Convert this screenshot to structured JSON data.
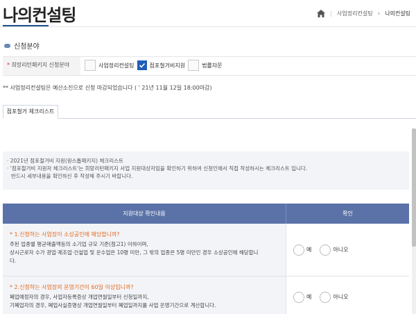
{
  "header": {
    "title": "나의컨설팅",
    "breadcrumb": [
      "사업정리컨설팅",
      "나의컨설팅"
    ]
  },
  "section": {
    "title": "신청분야"
  },
  "field": {
    "label": "희망리턴패키지 신청분야",
    "options": [
      {
        "label": "사업정리컨설팅",
        "checked": false
      },
      {
        "label": "점포철거비지원",
        "checked": true
      },
      {
        "label": "법률자문",
        "checked": false
      }
    ]
  },
  "notice": "** 사업정리컨설팅은 예산소진으로 신청 마감되었습니다 ( ' 21년 11월 12일 18:00마감)",
  "tabs": [
    {
      "label": "점포철거 체크리스트",
      "active": true
    }
  ],
  "info": {
    "lines": [
      "· 2021년 점포철거비 지원(원스톱패키지) 체크리스트",
      "· '점포철거비 지원자 체크리스트'는 희망리턴패키지 사업 지원대상자임을 확인하기 위하여 신청인에서 직접 작성하시는 체크리스트 입니다.",
      "반드시 세부내용을 확인하신 후 작성해 주시기 바랍니다."
    ]
  },
  "table": {
    "headers": [
      "지원대상 확인내용",
      "확인"
    ],
    "rows": [
      {
        "question": "* 1.신청하는 사업장이 소상공인에 해당합니까?",
        "desc": [
          "주된 업종별 평균매출액등의 소기업 규모 기준(첨고1) 이하이며,",
          "상시근로자 수가 광업·제조업·건설업 및 운수업은 10명 미만, 그 밖의 업종은 5명 미만인 경우 소상공인에 해당합니",
          "다."
        ],
        "yes": "예",
        "no": "아니오"
      },
      {
        "question": "* 2.신청하는 사업장의 운영기간이 60일 이상입니까?",
        "desc": [
          "폐업예정자의 경우, 사업자등록증상 개업연월일부터 신청일까지,",
          "기폐업자의 경우, 폐업사실증명상 개업연월일부터 폐업일까지를 사업 운영기간으로 계산합니다."
        ],
        "yes": "예",
        "no": "아니오"
      }
    ]
  },
  "colors": {
    "primary": "#1f5fb8",
    "table_header": "#5b72a8",
    "question": "#e16a1f"
  }
}
